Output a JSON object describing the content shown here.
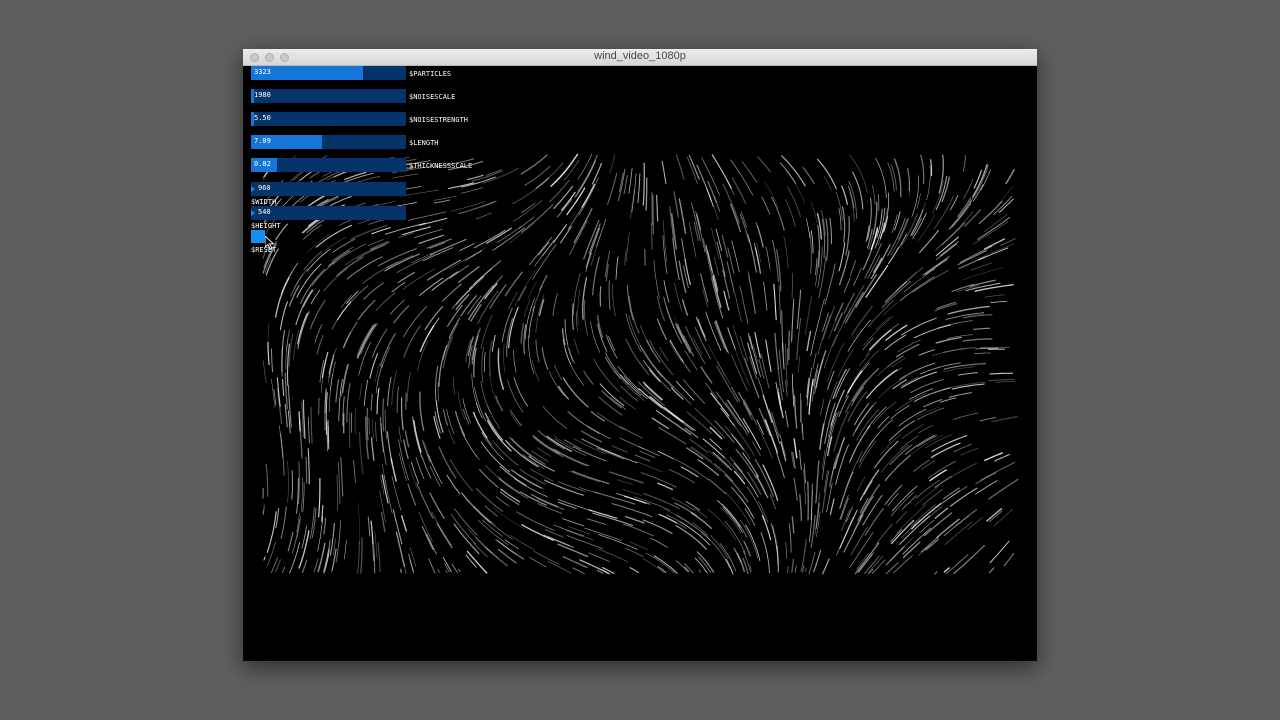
{
  "window": {
    "title": "wind_video_1080p"
  },
  "controls": {
    "particles": {
      "label": "$PARTICLES",
      "value": "3323",
      "fill": 0.72
    },
    "noise_scale": {
      "label": "$NOISESCALE",
      "value": "1980",
      "fill": 0.02
    },
    "noise_strength": {
      "label": "$NOISESTRENGTH",
      "value": "5.50",
      "fill": 0.02
    },
    "length": {
      "label": "$LENGTH",
      "value": "7.09",
      "fill": 0.46
    },
    "thickness_scale": {
      "label": "$THICKNESSSCALE",
      "value": "0.82",
      "fill": 0.17
    },
    "width": {
      "label": "$WIDTH",
      "value": "960",
      "fill": 0.02
    },
    "height": {
      "label": "$HEIGHT",
      "value": "540",
      "fill": 0.02
    },
    "reset": {
      "label": "$RESET"
    }
  },
  "colors": {
    "slider_track": "#07336b",
    "slider_fill": "#1676d8",
    "reset_button": "#1590f0",
    "canvas_background": "#000000",
    "desktop_background": "#5f5f5f"
  },
  "icons": {
    "close": "traffic-light-close",
    "minimize": "traffic-light-minimize",
    "zoom": "traffic-light-zoom",
    "pointer": "mouse-pointer-arrow"
  }
}
